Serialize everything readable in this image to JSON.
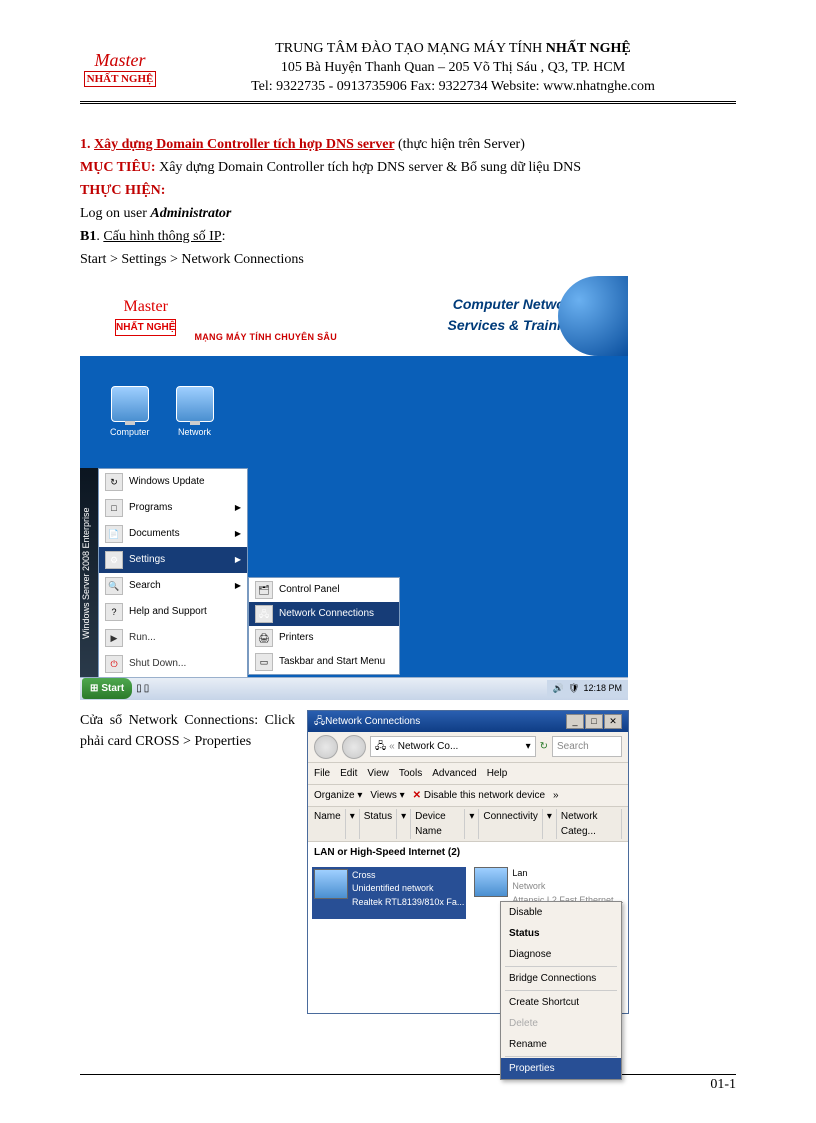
{
  "header": {
    "line1_pre": "TRUNG TÂM ĐÀO TẠO MẠNG MÁY TÍNH ",
    "line1_bold": "NHẤT NGHỆ",
    "line2": "105 Bà Huyện Thanh Quan – 205 Võ Thị Sáu , Q3, TP. HCM",
    "line3": "Tel: 9322735 - 0913735906 Fax: 9322734   Website: www.nhatnghe.com",
    "logo_script": "Master",
    "logo_name": "NHẤT NGHỆ"
  },
  "body": {
    "h1_num": "1. ",
    "h1_u": "Xây dựng Domain Controller tích hợp DNS server",
    "h1_tail": " (thực hiện trên Server)",
    "muctieu_label": "MỤC TIÊU: ",
    "muctieu_text": "Xây dựng Domain Controller tích hợp DNS server & Bổ sung dữ liệu DNS",
    "thuchien": "THỰC HIỆN:",
    "logon_pre": "Log on user ",
    "logon_b": "Administrator",
    "b1": "B1",
    "b1_tail": ". ",
    "b1_u": "Cấu hình thông số IP",
    "b1_colon": ":",
    "b1_path": "Start > Settings > Network Connections",
    "col_text": "Cửa sổ Network Connections: Click phải card CROSS > Properties"
  },
  "shot1": {
    "brand_top": "Computer Network",
    "brand_bot": "Services & Training",
    "slogan": "MẠNG MÁY TÍNH CHUYÊN SÂU",
    "icons": {
      "computer": "Computer",
      "network": "Network"
    },
    "start_sidebar": "Windows Server 2008 Enterprise",
    "menu": {
      "wu": "Windows Update",
      "programs": "Programs",
      "documents": "Documents",
      "settings": "Settings",
      "search": "Search",
      "help": "Help and Support",
      "run": "Run...",
      "shut": "Shut Down..."
    },
    "sub": {
      "cp": "Control Panel",
      "nc": "Network Connections",
      "printers": "Printers",
      "taskbar": "Taskbar and Start Menu"
    },
    "taskbar": {
      "start": "Start",
      "time": "12:18 PM"
    }
  },
  "shot2": {
    "title": "Network Connections",
    "addr_label": "Network Co...",
    "search_ph": "Search",
    "menus": [
      "File",
      "Edit",
      "View",
      "Tools",
      "Advanced",
      "Help"
    ],
    "toolbar": {
      "organize": "Organize ▾",
      "views": "Views ▾",
      "disable": "Disable this network device",
      "more": "»"
    },
    "cols": [
      "Name",
      "Status",
      "Device Name",
      "Connectivity",
      "Network Categ..."
    ],
    "cat": "LAN or High-Speed Internet (2)",
    "cross": {
      "name": "Cross",
      "status": "Unidentified network",
      "dev": "Realtek RTL8139/810x Fa..."
    },
    "lan": {
      "name": "Lan",
      "status": "Network",
      "dev": "Attansic L2 Fast Ethernet ..."
    },
    "ctx": {
      "disable": "Disable",
      "status": "Status",
      "diagnose": "Diagnose",
      "bridge": "Bridge Connections",
      "shortcut": "Create Shortcut",
      "delete": "Delete",
      "rename": "Rename",
      "props": "Properties"
    }
  },
  "footer": {
    "page": "01-1"
  }
}
